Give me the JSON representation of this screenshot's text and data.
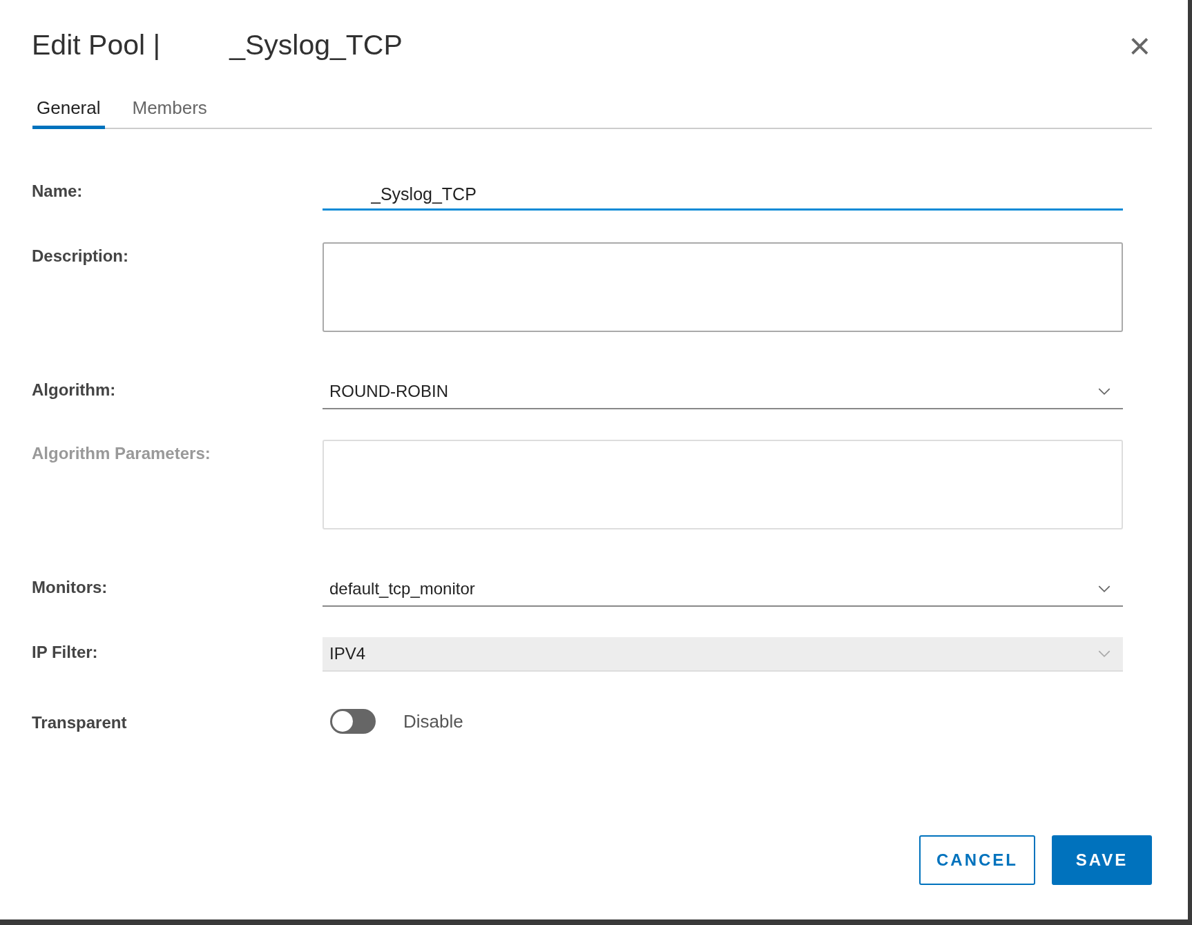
{
  "dialog": {
    "title": "Edit Pool |",
    "title_suffix": "_Syslog_TCP",
    "close_glyph": "×"
  },
  "tabs": [
    {
      "label": "General",
      "selected": true
    },
    {
      "label": "Members",
      "selected": false
    }
  ],
  "fields": [
    {
      "kind": "text",
      "label": "Name:",
      "value": "_Syslog_TCP",
      "focused": true,
      "disabled": false
    },
    {
      "kind": "textarea",
      "label": "Description:",
      "disabled": false
    },
    {
      "kind": "select",
      "label": "Algorithm:",
      "value": "ROUND-ROBIN",
      "disabled": false
    },
    {
      "kind": "textarea",
      "label": "Algorithm Parameters:",
      "disabled": true
    },
    {
      "kind": "select",
      "label": "Monitors:",
      "value": "default_tcp_monitor",
      "disabled": false
    },
    {
      "kind": "select",
      "label": "IP Filter:",
      "value": "IPV4",
      "disabled": true
    },
    {
      "kind": "toggle",
      "label": "Transparent",
      "on": false,
      "state_text": "Disable",
      "disabled": false
    }
  ],
  "buttons": [
    {
      "label": "CANCEL",
      "kind": "secondary"
    },
    {
      "label": "SAVE",
      "kind": "primary"
    }
  ]
}
